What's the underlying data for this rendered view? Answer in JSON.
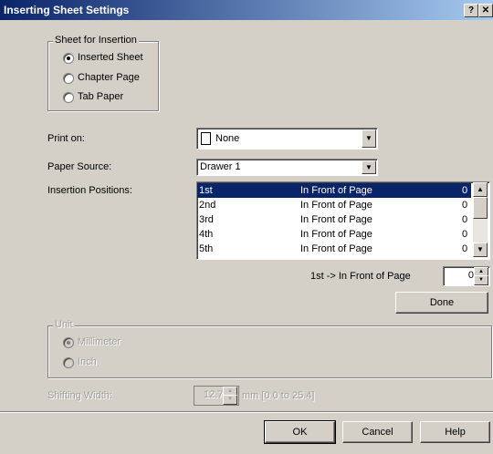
{
  "window": {
    "title": "Inserting Sheet Settings",
    "help_btn": "?",
    "close_btn": "✕"
  },
  "sheet_group": {
    "label": "Sheet for Insertion",
    "options": [
      "Inserted Sheet",
      "Chapter Page",
      "Tab Paper"
    ],
    "selected": "Inserted Sheet"
  },
  "print_on": {
    "label": "Print on:",
    "value": "None",
    "icon": "page-icon"
  },
  "paper_source": {
    "label": "Paper Source:",
    "value": "Drawer 1"
  },
  "insertion": {
    "label": "Insertion Positions:",
    "rows": [
      {
        "num": "1st",
        "pos": "In Front of Page",
        "val": "0"
      },
      {
        "num": "2nd",
        "pos": "In Front of Page",
        "val": "0"
      },
      {
        "num": "3rd",
        "pos": "In Front of Page",
        "val": "0"
      },
      {
        "num": "4th",
        "pos": "In Front of Page",
        "val": "0"
      },
      {
        "num": "5th",
        "pos": "In Front of Page",
        "val": "0"
      }
    ],
    "selected_index": 0,
    "summary": "1st -> In Front of Page",
    "stepper_value": "0"
  },
  "done_button": "Done",
  "unit_group": {
    "label": "Unit",
    "options": [
      "Millimeter",
      "Inch"
    ],
    "selected": "Millimeter"
  },
  "shifting": {
    "label": "Shifting Width:",
    "value": "12.7",
    "range": "mm [0.0 to 25.4]"
  },
  "footer": {
    "ok": "OK",
    "cancel": "Cancel",
    "help": "Help"
  },
  "colors": {
    "title_start": "#0a246a",
    "title_end": "#a6caf0",
    "face": "#d4d0c8",
    "selection": "#0a246a"
  }
}
